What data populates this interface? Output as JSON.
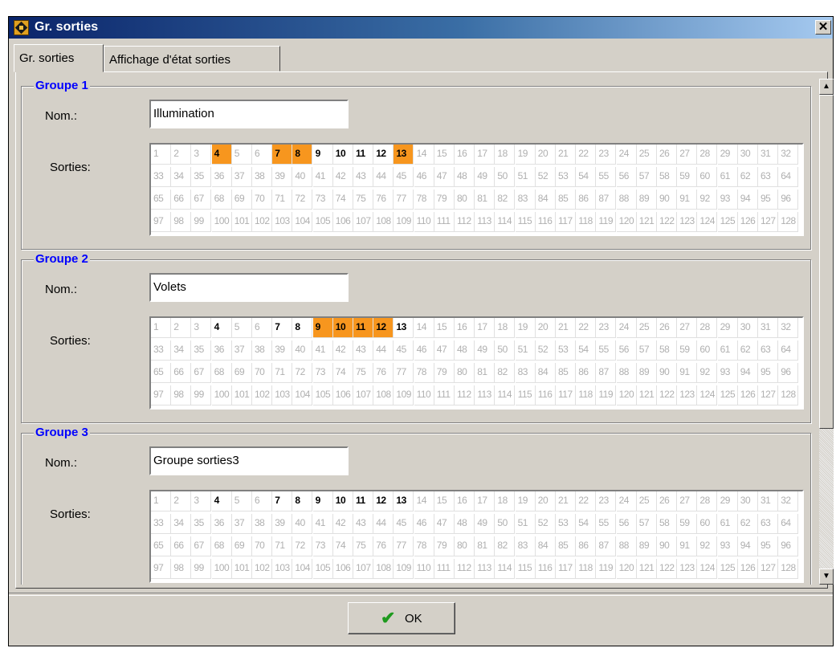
{
  "window": {
    "title": "Gr. sorties",
    "close_label": "✕"
  },
  "tabs": [
    {
      "label": "Gr. sorties",
      "active": true
    },
    {
      "label": "Affichage d'état sorties",
      "active": false
    }
  ],
  "labels": {
    "nom": "Nom.:",
    "sorties": "Sorties:"
  },
  "groups": [
    {
      "title": "Groupe 1",
      "name": "Illumination",
      "selected": [
        4,
        7,
        8,
        13
      ],
      "active": [
        9,
        10,
        11,
        12
      ]
    },
    {
      "title": "Groupe 2",
      "name": "Volets",
      "selected": [
        9,
        10,
        11,
        12
      ],
      "active": [
        4,
        7,
        8,
        13
      ]
    },
    {
      "title": "Groupe 3",
      "name": "Groupe sorties3",
      "selected": [],
      "active": [
        4,
        7,
        8,
        9,
        10,
        11,
        12,
        13
      ]
    }
  ],
  "outputs_count": 128,
  "colors": {
    "selected": "#f7961e",
    "active_text": "#000000",
    "inactive_text": "#b0b0b0",
    "group_title": "#0000ff"
  },
  "ok_button": {
    "label": "OK",
    "icon": "check-icon"
  }
}
